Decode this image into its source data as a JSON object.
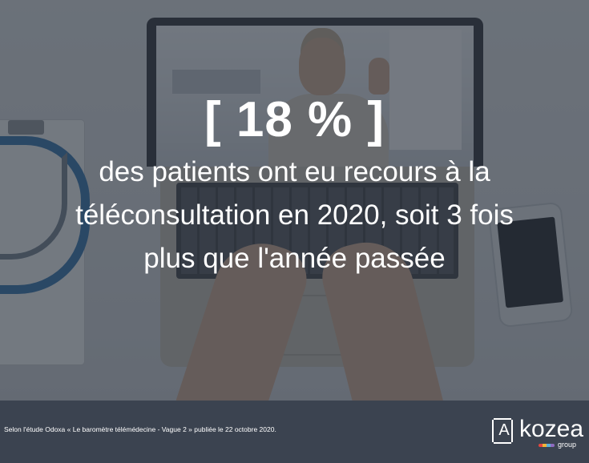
{
  "headline": {
    "stat": "[ 18 % ]",
    "caption": "des patients ont eu recours à la téléconsultation en 2020, soit 3 fois plus que l'année passée"
  },
  "footer": {
    "source": "Selon l'étude Odoxa « Le baromètre télémédecine - Vague 2 » publiée le 22 octobre 2020.",
    "logo": {
      "mark": "A",
      "word": "kozea",
      "sub": "group"
    }
  },
  "colors": {
    "footer_bg": "#3b4350",
    "text": "#ffffff",
    "overlay": "#28303c"
  }
}
